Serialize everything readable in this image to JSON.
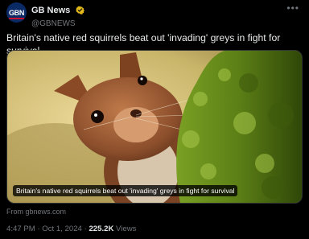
{
  "author": {
    "display_name": "GB News",
    "handle": "@GBNEWS",
    "avatar_text": "GBN"
  },
  "tweet": {
    "text": "Britain's native red squirrels beat out 'invading' greys in fight for survival"
  },
  "card": {
    "caption": "Britain's native red squirrels beat out 'invading' greys in fight for survival",
    "source": "From gbnews.com"
  },
  "meta": {
    "time": "4:47 PM",
    "date": "Oct 1, 2024",
    "separator": "·",
    "views_count": "225.2K",
    "views_label": "Views"
  },
  "icons": {
    "more": "more-icon",
    "verified": "verified-badge-icon"
  },
  "colors": {
    "background": "#000000",
    "verified": "#e2b719",
    "secondary_text": "#71767b"
  }
}
